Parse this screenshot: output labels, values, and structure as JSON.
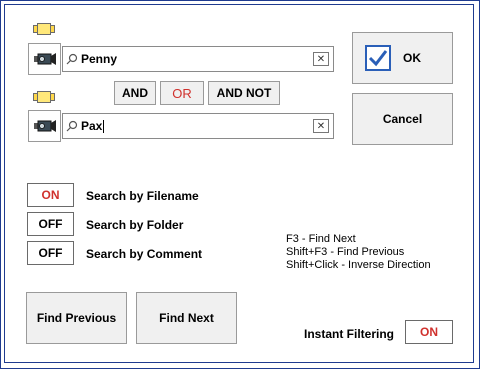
{
  "queries": [
    {
      "value": "Penny",
      "clear_symbol": "✕"
    },
    {
      "value": "Pax",
      "clear_symbol": "✕"
    }
  ],
  "operators": {
    "and": "AND",
    "or": "OR",
    "and_not": "AND NOT",
    "selected": "OR"
  },
  "actions": {
    "ok": "OK",
    "cancel": "Cancel",
    "find_previous": "Find Previous",
    "find_next": "Find Next"
  },
  "search_options": [
    {
      "state": "ON",
      "label": "Search by Filename"
    },
    {
      "state": "OFF",
      "label": "Search by Folder"
    },
    {
      "state": "OFF",
      "label": "Search by Comment"
    }
  ],
  "hints": [
    "F3 - Find Next",
    "Shift+F3 - Find Previous",
    "Shift+Click - Inverse Direction"
  ],
  "instant_filtering": {
    "label": "Instant Filtering",
    "state": "ON"
  },
  "colors": {
    "frame": "#1f3b8f",
    "on": "#d0312d",
    "ok_check": "#2a5fb8"
  },
  "icons": [
    "tag-icon",
    "video-camera-icon",
    "search-icon",
    "clear-icon",
    "checkmark-icon"
  ]
}
